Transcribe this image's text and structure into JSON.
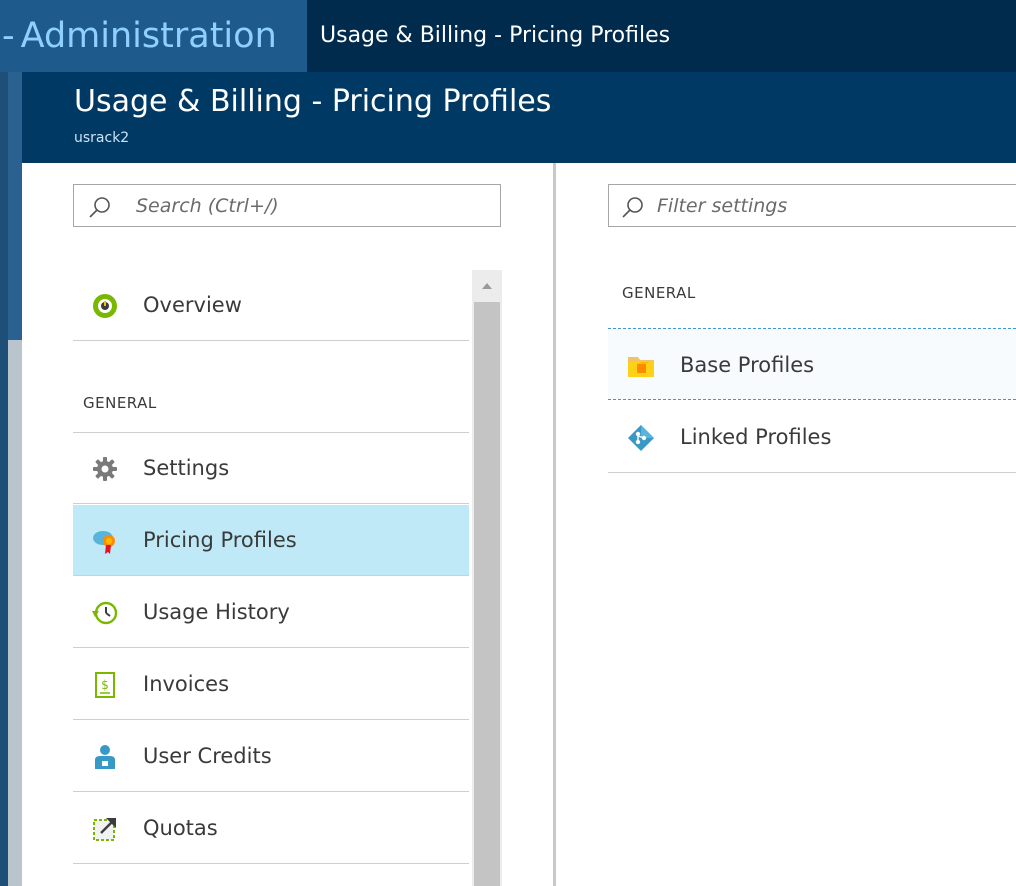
{
  "topbar": {
    "dash": "-",
    "admin_label": "Administration",
    "breadcrumb": "Usage & Billing - Pricing Profiles"
  },
  "blade": {
    "title": "Usage & Billing - Pricing Profiles",
    "subtitle": "usrack2"
  },
  "menu": {
    "search_placeholder": "Search (Ctrl+/)",
    "overview_label": "Overview",
    "section_general": "GENERAL",
    "items": [
      {
        "label": "Settings",
        "icon": "gear-icon"
      },
      {
        "label": "Pricing Profiles",
        "icon": "pricing-profile-icon",
        "selected": true
      },
      {
        "label": "Usage History",
        "icon": "history-icon"
      },
      {
        "label": "Invoices",
        "icon": "invoice-icon"
      },
      {
        "label": "User Credits",
        "icon": "user-icon"
      },
      {
        "label": "Quotas",
        "icon": "quota-icon"
      }
    ]
  },
  "settings": {
    "filter_placeholder": "Filter settings",
    "section_general": "GENERAL",
    "items": [
      {
        "label": "Base Profiles",
        "icon": "folder-icon",
        "focused": true
      },
      {
        "label": "Linked Profiles",
        "icon": "link-diamond-icon"
      }
    ]
  },
  "colors": {
    "topbar": "#002b4d",
    "admin_tile": "#1e5b8c",
    "blade_header": "#003a64",
    "selected_row": "#bfe9f6"
  }
}
